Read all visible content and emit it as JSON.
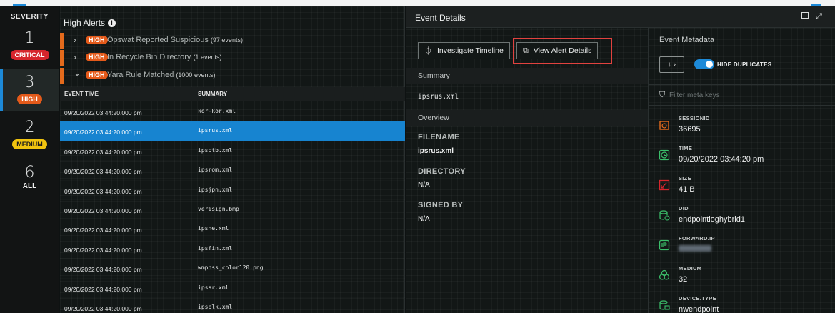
{
  "severity": {
    "title": "SEVERITY",
    "items": [
      {
        "count": "1",
        "label": "CRITICAL",
        "color": "#d6262d",
        "text_color": "#ffffff"
      },
      {
        "count": "3",
        "label": "HIGH",
        "color": "#e45a1a",
        "text_color": "#ffffff"
      },
      {
        "count": "2",
        "label": "MEDIUM",
        "color": "#f1c40f",
        "text_color": "#1a1a1a"
      },
      {
        "count": "6",
        "label": "ALL"
      }
    ]
  },
  "alerts": {
    "title": "High Alerts",
    "info_glyph": "i",
    "groups": [
      {
        "chevron": "›",
        "badge": "HIGH",
        "name": "Opswat Reported Suspicious",
        "count": "(97 events)"
      },
      {
        "chevron": "›",
        "badge": "HIGH",
        "name": "In Recycle Bin Directory",
        "count": "(1 events)"
      },
      {
        "chevron": "⌄",
        "badge": "HIGH",
        "name": "Yara Rule Matched",
        "count": "(1000 events)"
      }
    ],
    "columns": {
      "time": "EVENT TIME",
      "summary": "SUMMARY"
    },
    "rows": [
      {
        "time": "09/20/2022 03:44:20.000 pm",
        "summary": "kor-kor.xml"
      },
      {
        "time": "09/20/2022 03:44:20.000 pm",
        "summary": "ipsrus.xml"
      },
      {
        "time": "09/20/2022 03:44:20.000 pm",
        "summary": "ipsptb.xml"
      },
      {
        "time": "09/20/2022 03:44:20.000 pm",
        "summary": "ipsrom.xml"
      },
      {
        "time": "09/20/2022 03:44:20.000 pm",
        "summary": "ipsjpn.xml"
      },
      {
        "time": "09/20/2022 03:44:20.000 pm",
        "summary": "verisign.bmp"
      },
      {
        "time": "09/20/2022 03:44:20.000 pm",
        "summary": "ipshe.xml"
      },
      {
        "time": "09/20/2022 03:44:20.000 pm",
        "summary": "ipsfin.xml"
      },
      {
        "time": "09/20/2022 03:44:20.000 pm",
        "summary": "wmpnss_color120.png"
      },
      {
        "time": "09/20/2022 03:44:20.000 pm",
        "summary": "ipsar.xml"
      },
      {
        "time": "09/20/2022 03:44:20.000 pm",
        "summary": "ipsplk.xml"
      }
    ],
    "selected_index": 1
  },
  "event_details": {
    "title": "Event Details",
    "investigate_label": "Investigate Timeline",
    "view_alert_label": "View Alert Details",
    "summary_header": "Summary",
    "summary_value": "ipsrus.xml",
    "overview_header": "Overview",
    "fields": [
      {
        "label": "FILENAME",
        "value": "ipsrus.xml"
      },
      {
        "label": "DIRECTORY",
        "value": "N/A"
      },
      {
        "label": "SIGNED BY",
        "value": "N/A"
      }
    ]
  },
  "metadata": {
    "title": "Event Metadata",
    "sort_glyph": "↓",
    "hide_duplicates_label": "HIDE DUPLICATES",
    "filter_placeholder": "Filter meta keys",
    "items": [
      {
        "key": "SESSIONID",
        "value": "36695",
        "icon": "session-icon",
        "icon_color": "#e36a1c"
      },
      {
        "key": "TIME",
        "value": "09/20/2022 03:44:20 pm",
        "icon": "clock-icon",
        "icon_color": "#3bbf6a"
      },
      {
        "key": "SIZE",
        "value": "41 B",
        "icon": "size-icon",
        "icon_color": "#d6262d"
      },
      {
        "key": "DID",
        "value": "endpointloghybrid1",
        "icon": "database-icon",
        "icon_color": "#3bbf6a"
      },
      {
        "key": "FORWARD.IP",
        "value": "",
        "icon": "ip-icon",
        "icon_color": "#3bbf6a"
      },
      {
        "key": "MEDIUM",
        "value": "32",
        "icon": "medium-icon",
        "icon_color": "#3bbf6a"
      },
      {
        "key": "DEVICE.TYPE",
        "value": "nwendpoint",
        "icon": "device-icon",
        "icon_color": "#3bbf6a"
      }
    ]
  }
}
